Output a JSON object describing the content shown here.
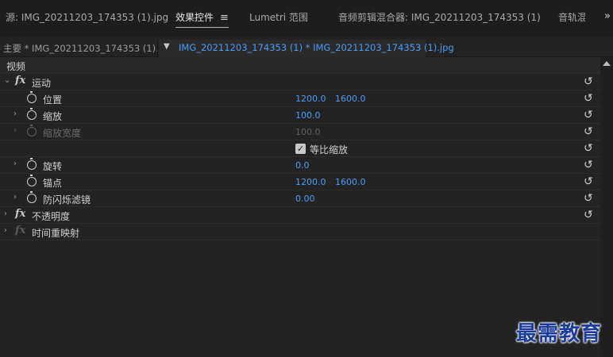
{
  "top_tabs": {
    "source": "源: IMG_20211203_174353 (1).jpg",
    "effect_controls": "效果控件",
    "effect_controls_menu": "≡",
    "lumetri": "Lumetri 范围",
    "audio_mixer": "音频剪辑混合器: IMG_20211203_174353 (1)",
    "audio_track": "音轨混",
    "overflow": "»"
  },
  "clip_row": {
    "master": "主要 * IMG_20211203_174353 (1).jpg",
    "selected_clip": "IMG_20211203_174353 (1) * IMG_20211203_174353 (1).jpg"
  },
  "section_header": "视频",
  "effects": {
    "motion": {
      "label": "运动"
    },
    "position": {
      "label": "位置",
      "x": "1200.0",
      "y": "1600.0"
    },
    "scale": {
      "label": "缩放",
      "value": "100.0"
    },
    "scale_width": {
      "label": "缩放宽度",
      "value": "100.0"
    },
    "uniform_scale": {
      "label": "等比缩放",
      "checked": true
    },
    "rotation": {
      "label": "旋转",
      "value": "0.0"
    },
    "anchor": {
      "label": "锚点",
      "x": "1200.0",
      "y": "1600.0"
    },
    "anti_flicker": {
      "label": "防闪烁滤镜",
      "value": "0.00"
    },
    "opacity": {
      "label": "不透明度"
    },
    "time_remap": {
      "label": "时间重映射"
    }
  },
  "icons": {
    "reset": "↺",
    "fx": "fx",
    "check": "✓"
  },
  "watermark": "最需教育",
  "colors": {
    "accent_blue": "#4b9cf6",
    "panel_bg": "#232323",
    "watermark": "#1b3c9b"
  }
}
